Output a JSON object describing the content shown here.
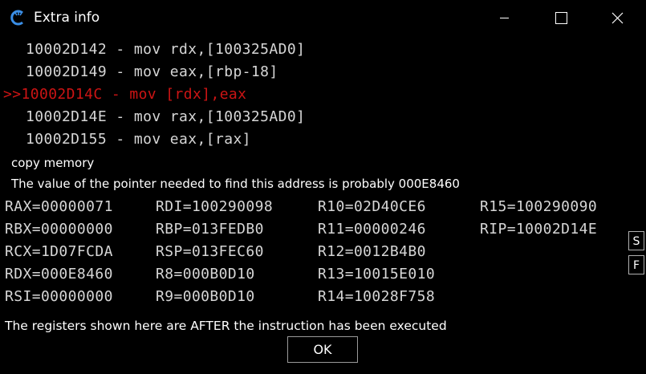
{
  "window": {
    "title": "Extra info",
    "icon": "cheat-engine-icon",
    "controls": [
      "minimize-icon",
      "maximize-icon",
      "close-icon"
    ]
  },
  "disassembly": {
    "current_marker": ">>",
    "lines": [
      {
        "text": "10002D142 - mov rdx,[100325AD0]",
        "current": false
      },
      {
        "text": "10002D149 - mov eax,[rbp-18]",
        "current": false
      },
      {
        "text": "10002D14C - mov [rdx],eax",
        "current": true
      },
      {
        "text": "10002D14E - mov rax,[100325AD0]",
        "current": false
      },
      {
        "text": "10002D155 - mov eax,[rax]",
        "current": false
      }
    ]
  },
  "info": {
    "operation": "copy memory",
    "pointer_note": "The value of the pointer needed to find this address is probably 000E8460"
  },
  "registers": {
    "rows": [
      [
        "RAX=00000071",
        "RDI=100290098",
        "R10=02D40CE6",
        "R15=100290090"
      ],
      [
        "RBX=00000000",
        "RBP=013FEDB0",
        "R11=00000246",
        "RIP=10002D14E"
      ],
      [
        "RCX=1D07FCDA",
        "RSP=013FEC60",
        "R12=0012B4B0",
        ""
      ],
      [
        "RDX=000E8460",
        "R8=000B0D10",
        "R13=10015E010",
        ""
      ],
      [
        "RSI=00000000",
        "R9=000B0D10",
        "R14=10028F758",
        ""
      ]
    ]
  },
  "side_buttons": {
    "s_label": "S",
    "f_label": "F"
  },
  "footer": {
    "note": "The registers shown here are AFTER the instruction has been executed",
    "ok_label": "OK"
  },
  "colors": {
    "background": "#000000",
    "text": "#d6d6d6",
    "current_instruction": "#cc1414"
  }
}
